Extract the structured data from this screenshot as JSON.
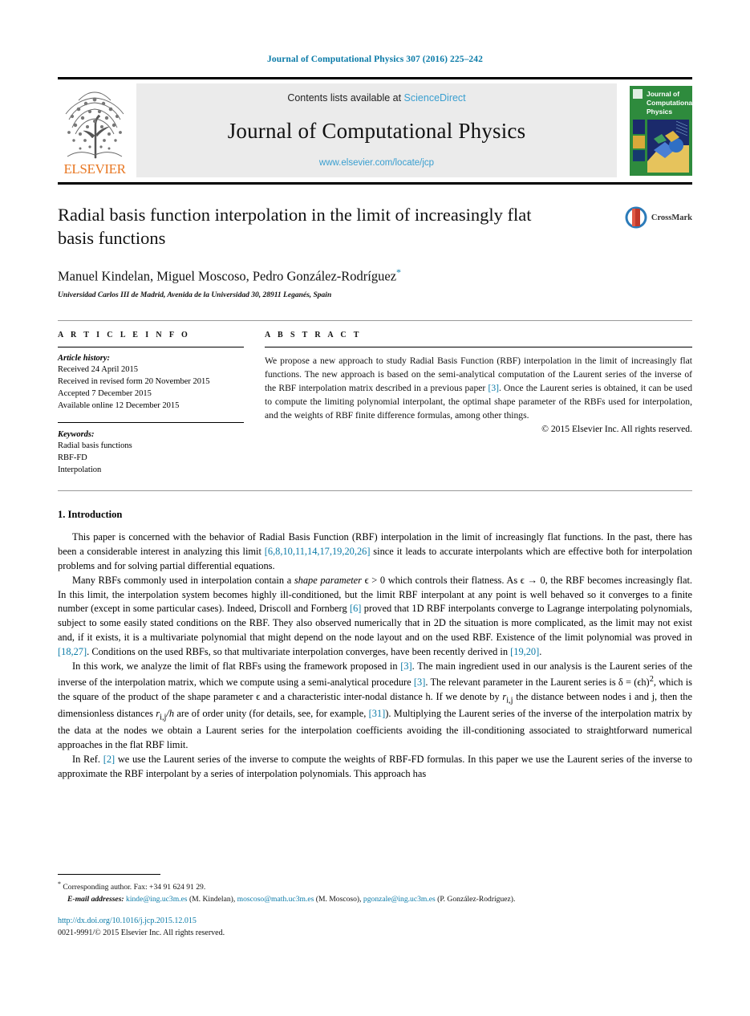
{
  "running_head": "Journal of Computational Physics 307 (2016) 225–242",
  "masthead": {
    "publisher_wordmark": "ELSEVIER",
    "contents_prefix": "Contents lists available at ",
    "sciencedirect": "ScienceDirect",
    "journal_name": "Journal of Computational Physics",
    "journal_url": "www.elsevier.com/locate/jcp",
    "cover_title_line1": "Journal of",
    "cover_title_line2": "Computational",
    "cover_title_line3": "Physics"
  },
  "article": {
    "title": "Radial basis function interpolation in the limit of increasingly flat basis functions",
    "authors": "Manuel Kindelan, Miguel Moscoso, Pedro González-Rodríguez",
    "corresponding_marker": "*",
    "affiliation": "Universidad Carlos III de Madrid, Avenida de la Universidad 30, 28911 Leganés, Spain",
    "crossmark_label": "CrossMark"
  },
  "info": {
    "heading": "A R T I C L E   I N F O",
    "history_label": "Article history:",
    "history": [
      "Received 24 April 2015",
      "Received in revised form 20 November 2015",
      "Accepted 7 December 2015",
      "Available online 12 December 2015"
    ],
    "keywords_label": "Keywords:",
    "keywords": [
      "Radial basis functions",
      "RBF-FD",
      "Interpolation"
    ]
  },
  "abstract": {
    "heading": "A B S T R A C T",
    "part1": "We propose a new approach to study Radial Basis Function (RBF) interpolation in the limit of increasingly flat functions. The new approach is based on the semi-analytical computation of the Laurent series of the inverse of the RBF interpolation matrix described in a previous paper ",
    "cite1": "[3]",
    "part2": ". Once the Laurent series is obtained, it can be used to compute the limiting polynomial interpolant, the optimal shape parameter of the RBFs used for interpolation, and the weights of RBF finite difference formulas, among other things.",
    "copyright": "© 2015 Elsevier Inc. All rights reserved."
  },
  "body": {
    "section_title": "1. Introduction",
    "p1_a": "This paper is concerned with the behavior of Radial Basis Function (RBF) interpolation in the limit of increasingly flat functions. In the past, there has been a considerable interest in analyzing this limit ",
    "p1_cite": "[6,8,10,11,14,17,19,20,26]",
    "p1_b": " since it leads to accurate interpolants which are effective both for interpolation problems and for solving partial differential equations.",
    "p2_a": "Many RBFs commonly used in interpolation contain a ",
    "p2_em": "shape parameter",
    "p2_b": " ϵ > 0 which controls their flatness. As ϵ → 0, the RBF becomes increasingly flat. In this limit, the interpolation system becomes highly ill-conditioned, but the limit RBF interpolant at any point is well behaved so it converges to a finite number (except in some particular cases). Indeed, Driscoll and Fornberg ",
    "p2_cite1": "[6]",
    "p2_c": " proved that 1D RBF interpolants converge to Lagrange interpolating polynomials, subject to some easily stated conditions on the RBF. They also observed numerically that in 2D the situation is more complicated, as the limit may not exist and, if it exists, it is a multivariate polynomial that might depend on the node layout and on the used RBF. Existence of the limit polynomial was proved in ",
    "p2_cite2": "[18,27]",
    "p2_d": ". Conditions on the used RBFs, so that multivariate interpolation converges, have been recently derived in ",
    "p2_cite3": "[19,20]",
    "p2_e": ".",
    "p3_a": "In this work, we analyze the limit of flat RBFs using the framework proposed in ",
    "p3_cite1": "[3]",
    "p3_b": ". The main ingredient used in our analysis is the Laurent series of the inverse of the interpolation matrix, which we compute using a semi-analytical procedure ",
    "p3_cite2": "[3]",
    "p3_c": ". The relevant parameter in the Laurent series is δ = (ϵh)",
    "p3_sup": "2",
    "p3_d": ", which is the square of the product of the shape parameter ϵ and a characteristic inter-nodal distance h. If we denote by ",
    "p3_r1": "r",
    "p3_r1sub": "i,j",
    "p3_e": " the distance between nodes i and j, then the dimensionless distances ",
    "p3_r2": "r",
    "p3_r2sub": "i,j",
    "p3_r2tail": "/h",
    "p3_f": " are of order unity (for details, see, for example, ",
    "p3_cite3": "[31]",
    "p3_g": "). Multiplying the Laurent series of the inverse of the interpolation matrix by the data at the nodes we obtain a Laurent series for the interpolation coefficients avoiding the ill-conditioning associated to straightforward numerical approaches in the flat RBF limit.",
    "p4_a": "In Ref. ",
    "p4_cite": "[2]",
    "p4_b": " we use the Laurent series of the inverse to compute the weights of RBF-FD formulas. In this paper we use the Laurent series of the inverse to approximate the RBF interpolant by a series of interpolation polynomials. This approach has"
  },
  "footnotes": {
    "corresponding": "Corresponding author. Fax: +34 91 624 91 29.",
    "email_label": "E-mail addresses:",
    "emails": [
      {
        "address": "kinde@ing.uc3m.es",
        "who": "(M. Kindelan)"
      },
      {
        "address": "moscoso@math.uc3m.es",
        "who": "(M. Moscoso)"
      },
      {
        "address": "pgonzale@ing.uc3m.es",
        "who": "(P. González-Rodríguez)"
      }
    ],
    "doi": "http://dx.doi.org/10.1016/j.jcp.2015.12.015",
    "issn": "0021-9991/© 2015 Elsevier Inc. All rights reserved."
  },
  "colors": {
    "link_blue": "#0b7ba8",
    "sciencedirect_blue": "#3a9fd0",
    "elsevier_orange": "#E87722",
    "cover_green": "#2e8b3d"
  }
}
